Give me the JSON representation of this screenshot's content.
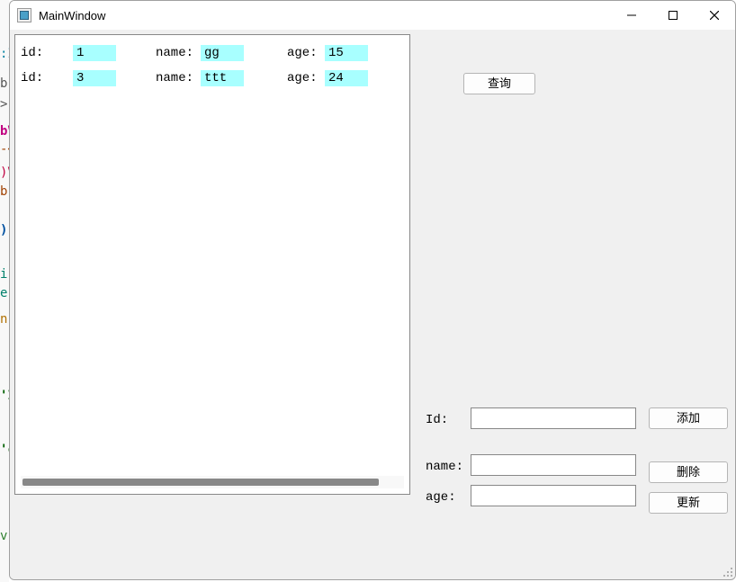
{
  "window": {
    "title": "MainWindow"
  },
  "list": {
    "rows": [
      {
        "id_label": "id:",
        "id": "1",
        "name_label": "name:",
        "name": "gg",
        "age_label": "age:",
        "age": "15"
      },
      {
        "id_label": "id:",
        "id": "3",
        "name_label": "name:",
        "name": "ttt",
        "age_label": "age:",
        "age": "24"
      }
    ]
  },
  "buttons": {
    "query": "查询",
    "add": "添加",
    "delete": "删除",
    "update": "更新"
  },
  "form": {
    "id_label": "Id:",
    "name_label": "name:",
    "age_label": "age:",
    "id_value": "",
    "name_value": "",
    "age_value": ""
  },
  "colors": {
    "highlight": "#a8ffff",
    "window_bg": "#f0f0f0"
  }
}
